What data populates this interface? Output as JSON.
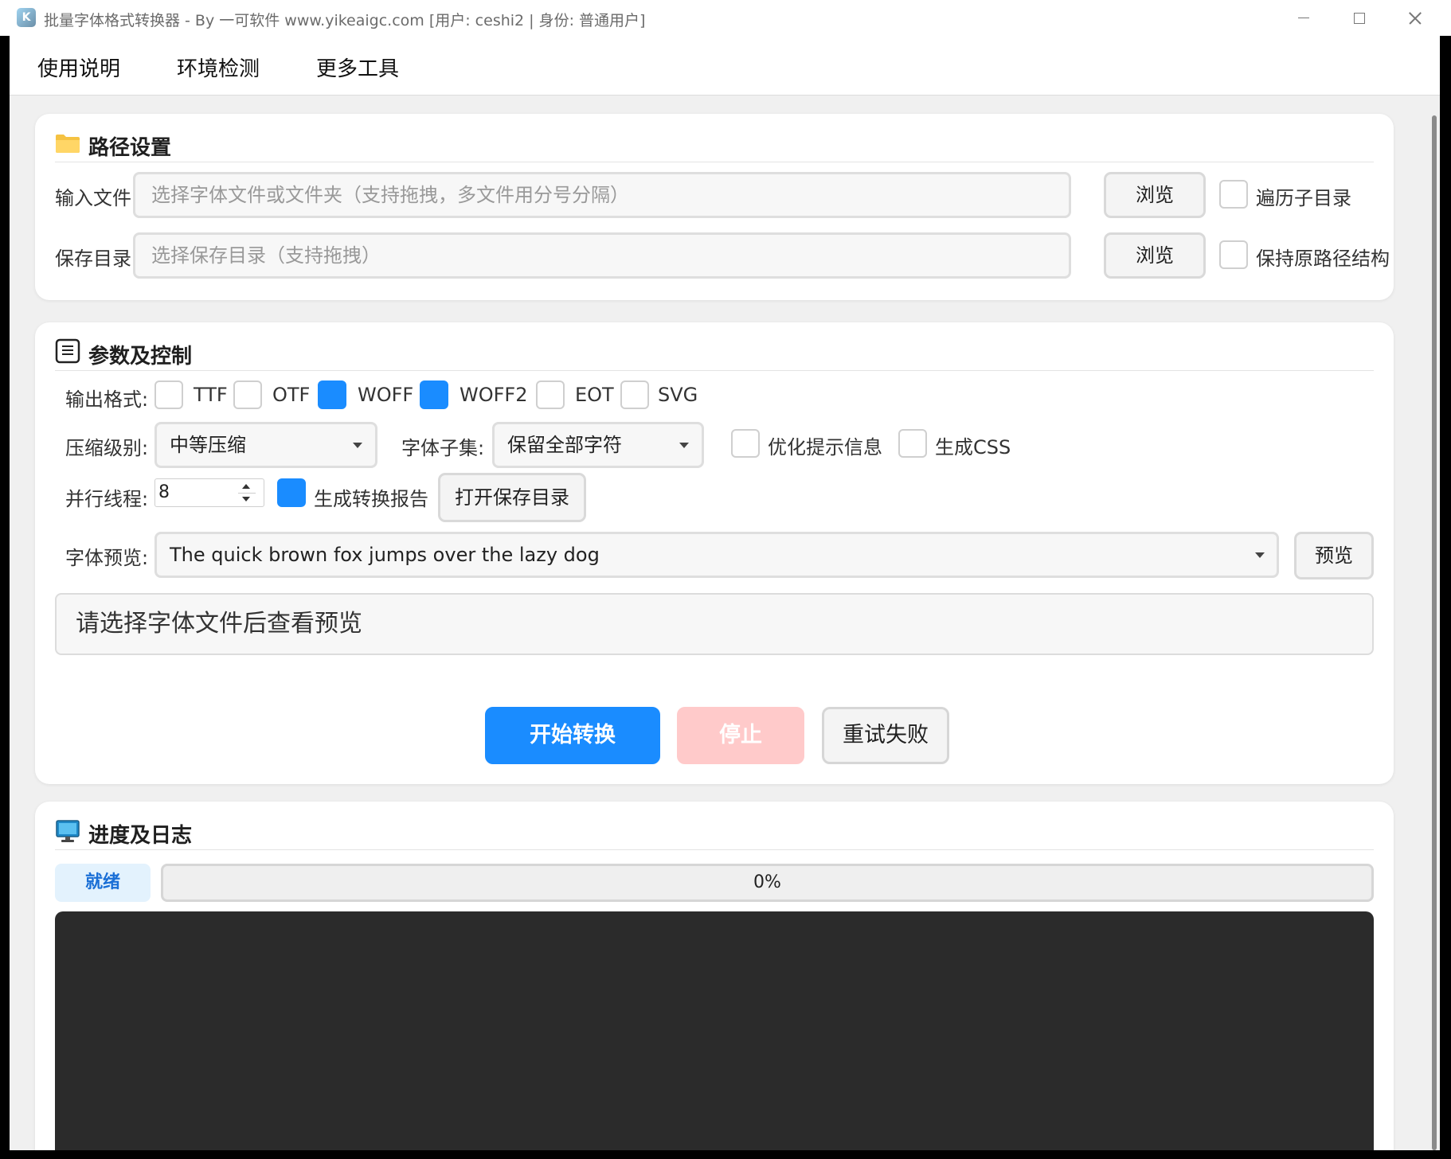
{
  "window": {
    "title": "批量字体格式转换器 - By 一可软件 www.yikeaigc.com [用户: ceshi2 | 身份: 普通用户]",
    "app_icon_text": "K"
  },
  "menu": [
    "使用说明",
    "环境检测",
    "更多工具"
  ],
  "path_section": {
    "title": "路径设置",
    "input_label": "输入文件:",
    "input_placeholder": "选择字体文件或文件夹（支持拖拽，多文件用分号分隔）",
    "input_value": "",
    "save_label": "保存目录:",
    "save_placeholder": "选择保存目录（支持拖拽）",
    "save_value": "",
    "browse_label": "浏览",
    "recurse_label": "遍历子目录",
    "recurse_checked": false,
    "keep_structure_label": "保持原路径结构",
    "keep_structure_checked": false
  },
  "params_section": {
    "title": "参数及控制",
    "format_label": "输出格式:",
    "formats": [
      {
        "name": "TTF",
        "checked": false
      },
      {
        "name": "OTF",
        "checked": false
      },
      {
        "name": "WOFF",
        "checked": true
      },
      {
        "name": "WOFF2",
        "checked": true
      },
      {
        "name": "EOT",
        "checked": false
      },
      {
        "name": "SVG",
        "checked": false
      }
    ],
    "compress_label": "压缩级别:",
    "compress_value": "中等压缩",
    "subset_label": "字体子集:",
    "subset_value": "保留全部字符",
    "hinting_label": "优化提示信息",
    "hinting_checked": false,
    "css_label": "生成CSS",
    "css_checked": false,
    "threads_label": "并行线程:",
    "threads_value": "8",
    "report_label": "生成转换报告",
    "report_checked": true,
    "open_dir_label": "打开保存目录",
    "preview_label": "字体预览:",
    "preview_text": "The quick brown fox jumps over the lazy dog",
    "preview_button": "预览",
    "preview_placeholder": "请选择字体文件后查看预览",
    "start_label": "开始转换",
    "stop_label": "停止",
    "retry_label": "重试失败"
  },
  "log_section": {
    "title": "进度及日志",
    "status": "就绪",
    "progress": 0,
    "progress_text": "0%"
  },
  "colors": {
    "accent": "#1a8cff",
    "stop_disabled": "#ffcaca",
    "log_bg": "#2b2b2b",
    "status_bg": "#e3f2fd"
  }
}
